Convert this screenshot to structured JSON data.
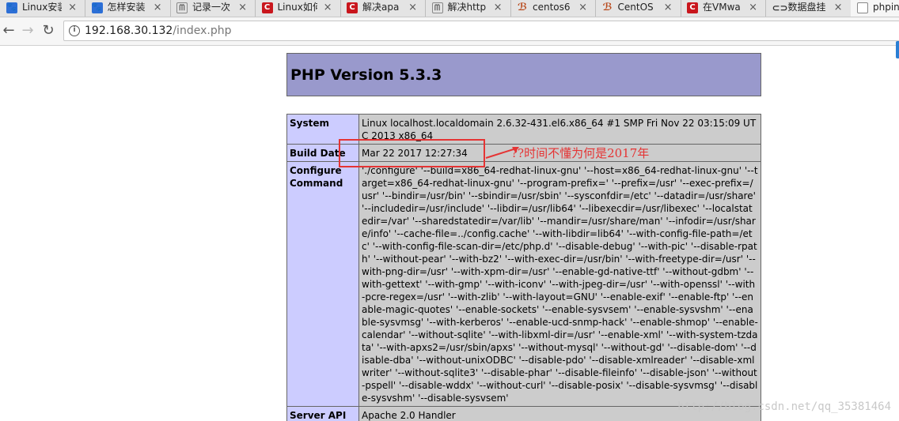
{
  "tabs": [
    {
      "title": "Linux安装",
      "favicon": "baidu-paw-icon",
      "fav_glyph": "🐾",
      "close": "×"
    },
    {
      "title": "怎样安装",
      "favicon": "baidu-paw-icon",
      "fav_glyph": "🐾",
      "close": "×"
    },
    {
      "title": "记录一次",
      "favicon": "cnblogs-icon",
      "fav_glyph": "ᗰ",
      "close": "×"
    },
    {
      "title": "Linux如何",
      "favicon": "csdn-icon",
      "fav_glyph": "C",
      "close": "×"
    },
    {
      "title": "解决apa",
      "favicon": "csdn-icon",
      "fav_glyph": "C",
      "close": "×"
    },
    {
      "title": "解决http",
      "favicon": "cnblogs-icon",
      "fav_glyph": "ᗰ",
      "close": "×"
    },
    {
      "title": "centos6",
      "favicon": "jianshu-icon",
      "fav_glyph": "ℬ",
      "close": "×"
    },
    {
      "title": "CentOS",
      "favicon": "jianshu-icon",
      "fav_glyph": "ℬ",
      "close": "×"
    },
    {
      "title": "在VMwa",
      "favicon": "csdn-icon",
      "fav_glyph": "C",
      "close": "×"
    },
    {
      "title": "数据盘挂",
      "favicon": "data-icon",
      "fav_glyph": "⊂⊃",
      "close": "×"
    },
    {
      "title": "phpinfo",
      "favicon": "page-icon",
      "fav_glyph": "",
      "close": ""
    }
  ],
  "toolbar": {
    "back_glyph": "←",
    "forward_glyph": "→",
    "reload_glyph": "↻",
    "info_glyph": "i",
    "url_host": "192.168.30.132",
    "url_path": "/index.php"
  },
  "php": {
    "title": "PHP Version 5.3.3",
    "rows": [
      {
        "label": "System",
        "value": "Linux localhost.localdomain 2.6.32-431.el6.x86_64 #1 SMP Fri Nov 22 03:15:09 UTC 2013 x86_64"
      },
      {
        "label": "Build Date",
        "value": "Mar 22 2017 12:27:34"
      },
      {
        "label": "Configure Command",
        "value": "'./configure' '--build=x86_64-redhat-linux-gnu' '--host=x86_64-redhat-linux-gnu' '--target=x86_64-redhat-linux-gnu' '--program-prefix=' '--prefix=/usr' '--exec-prefix=/usr' '--bindir=/usr/bin' '--sbindir=/usr/sbin' '--sysconfdir=/etc' '--datadir=/usr/share' '--includedir=/usr/include' '--libdir=/usr/lib64' '--libexecdir=/usr/libexec' '--localstatedir=/var' '--sharedstatedir=/var/lib' '--mandir=/usr/share/man' '--infodir=/usr/share/info' '--cache-file=../config.cache' '--with-libdir=lib64' '--with-config-file-path=/etc' '--with-config-file-scan-dir=/etc/php.d' '--disable-debug' '--with-pic' '--disable-rpath' '--without-pear' '--with-bz2' '--with-exec-dir=/usr/bin' '--with-freetype-dir=/usr' '--with-png-dir=/usr' '--with-xpm-dir=/usr' '--enable-gd-native-ttf' '--without-gdbm' '--with-gettext' '--with-gmp' '--with-iconv' '--with-jpeg-dir=/usr' '--with-openssl' '--with-pcre-regex=/usr' '--with-zlib' '--with-layout=GNU' '--enable-exif' '--enable-ftp' '--enable-magic-quotes' '--enable-sockets' '--enable-sysvsem' '--enable-sysvshm' '--enable-sysvmsg' '--with-kerberos' '--enable-ucd-snmp-hack' '--enable-shmop' '--enable-calendar' '--without-sqlite' '--with-libxml-dir=/usr' '--enable-xml' '--with-system-tzdata' '--with-apxs2=/usr/sbin/apxs' '--without-mysql' '--without-gd' '--disable-dom' '--disable-dba' '--without-unixODBC' '--disable-pdo' '--disable-xmlreader' '--disable-xmlwriter' '--without-sqlite3' '--disable-phar' '--disable-fileinfo' '--disable-json' '--without-pspell' '--disable-wddx' '--without-curl' '--disable-posix' '--disable-sysvmsg' '--disable-sysvshm' '--disable-sysvsem'"
      },
      {
        "label": "Server API",
        "value": "Apache 2.0 Handler"
      }
    ]
  },
  "annotation": {
    "text": "??时间不懂为何是2017年",
    "color": "#e53434"
  },
  "watermark": "http://blog.csdn.net/qq_35381464"
}
